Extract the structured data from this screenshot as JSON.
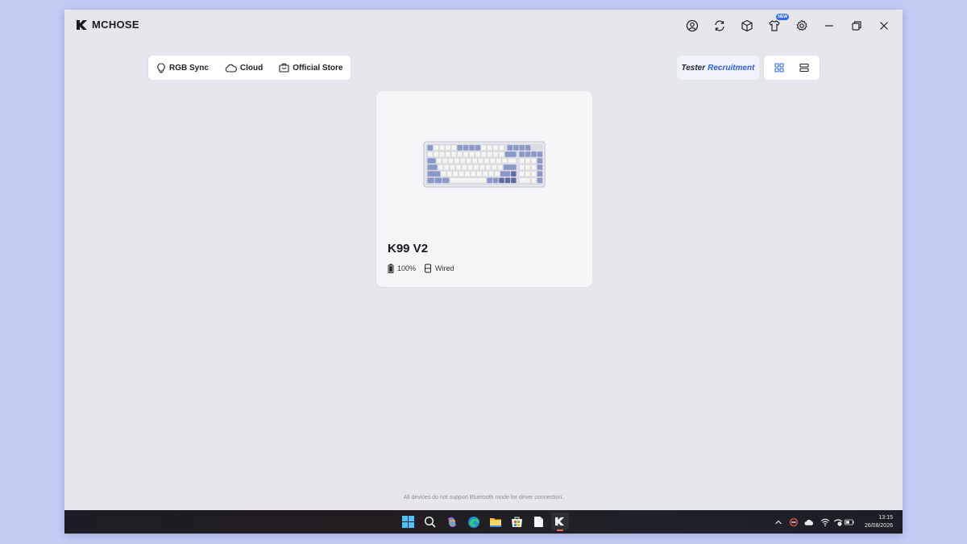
{
  "app": {
    "name": "MCHOSE"
  },
  "titlebar": {
    "icons": [
      "user-icon",
      "sync-icon",
      "box-icon",
      "shirt-icon",
      "settings-icon",
      "minimize-icon",
      "restore-icon",
      "close-icon"
    ],
    "new_badge": "NEW"
  },
  "nav": {
    "items": [
      {
        "label": "RGB Sync",
        "icon": "bulb-icon"
      },
      {
        "label": "Cloud",
        "icon": "cloud-icon"
      },
      {
        "label": "Official Store",
        "icon": "store-icon"
      }
    ]
  },
  "tester": {
    "part1": "Tester",
    "part2": "Recruitment"
  },
  "view_toggle": {
    "options": [
      "grid-view-icon",
      "list-view-icon"
    ],
    "active": "grid"
  },
  "device": {
    "name": "K99 V2",
    "battery": "100%",
    "connection": "Wired"
  },
  "footnote": "All devices do not support Bluetooth mode for driver connection.",
  "taskbar": {
    "apps": [
      "windows-start-icon",
      "search-icon",
      "copilot-icon",
      "edge-icon",
      "file-explorer-icon",
      "store-icon",
      "notepad-icon",
      "mchose-icon"
    ],
    "tray": [
      "chevron-up-icon",
      "app-tray-icon",
      "onedrive-icon",
      "wifi-icon",
      "network-icon",
      "battery-icon"
    ],
    "time": "13:15",
    "date": "26/08/2026"
  },
  "colors": {
    "accent": "#2d5fe8",
    "window_bg": "#e6e7ec",
    "desktop_bg": "#c3cdf4"
  }
}
